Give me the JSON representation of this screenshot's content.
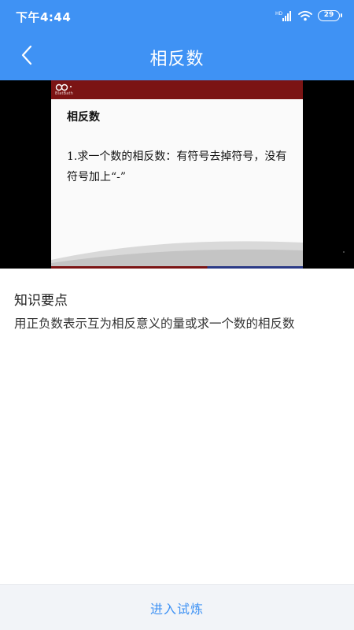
{
  "status_bar": {
    "time": "下午4:44",
    "network_label": "HD",
    "battery": "29"
  },
  "navbar": {
    "back_icon": "chevron-left-icon",
    "title": "相反数"
  },
  "video": {
    "slide_logo_text": "BlatBath",
    "slide_heading": "相反数",
    "slide_body": "1.求一个数的相反数：有符号去掉符号，没有符号加上“-”"
  },
  "knowledge": {
    "title": "知识要点",
    "description": "用正负数表示互为相反意义的量或求一个数的相反数"
  },
  "footer": {
    "button_label": "进入试炼"
  },
  "colors": {
    "header": "#3f92f4",
    "accent": "#3f92f4",
    "slide_bar": "#7b1414",
    "footer_bg": "#f2f4f8"
  }
}
